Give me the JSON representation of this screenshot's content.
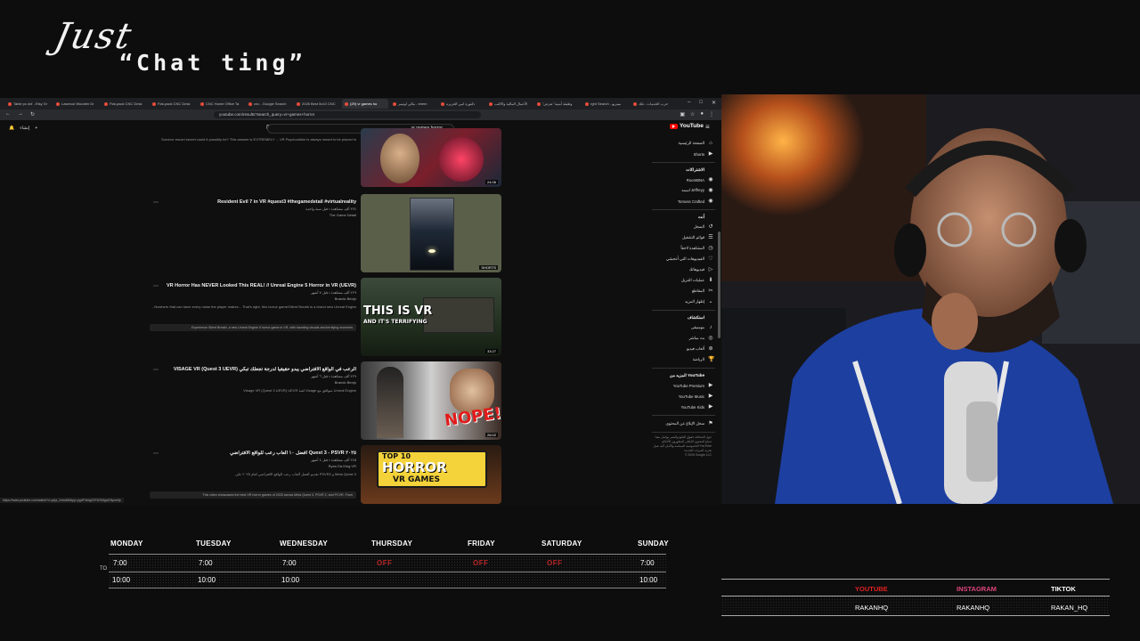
{
  "overlay": {
    "title_line1": "Just",
    "title_line2": "“Chat ting”"
  },
  "browser": {
    "tabs": [
      {
        "label": "Table pc dxf - Etsy Gr",
        "active": false
      },
      {
        "label": "Lasercut Wooden Dr",
        "active": false
      },
      {
        "label": "Flat-pack CNC Desk",
        "active": false
      },
      {
        "label": "Flat-pack CNC Desk",
        "active": false
      },
      {
        "label": "CNC Home Office Ta",
        "active": false
      },
      {
        "label": "cnc - Google Search",
        "active": false
      },
      {
        "label": "2026 Best 5x10 CNC",
        "active": false
      },
      {
        "label": "(29) vr games ho",
        "active": true
      },
      {
        "label": "مالي اوتيمر - xtrem",
        "active": false
      },
      {
        "label": "دكتورة امي الجزيره",
        "active": false
      },
      {
        "label": "الأعمال المالية والاكتب",
        "active": false
      },
      {
        "label": "\"وظيفة أمنية\" تعرض",
        "active": false
      },
      {
        "label": "rght Search - ميتريو",
        "active": false
      },
      {
        "label": "حرب الخدمات - تلك",
        "active": false
      }
    ],
    "url": "youtube.com/results?search_query=vr+games+horror",
    "status_url": "https://www.youtube.com/watch?v=yeja_Xrkw8M&pp=ygUPdnIgZ2FtZXMgaG9ycm9y"
  },
  "youtube": {
    "search_value": "vr games horror",
    "brand": "YouTube",
    "create_label": "إنشاء",
    "results": [
      {
        "title": "",
        "meta": "",
        "channel": "",
        "desc": "Survivor escort secret could it possibly be? This answer is EXTREMELY ... VR Psychostrike is always meant to be placed in",
        "duration": "24:06",
        "chapters": ""
      },
      {
        "title": "Resident Evil 7 in VR #quest3 #thegamedetail #virtualreality",
        "meta": "٢٢٤ ألف مشاهدة • قبل سنة واحدة",
        "channel": "The Game Detail",
        "desc": "",
        "duration": "SHORTS",
        "chapters": ""
      },
      {
        "title": "VR Horror Has NEVER Looked This REAL! // Unreal Engine 5 Horror in VR (UEVR)",
        "meta": "٢٢٩ ألف مشاهدة • قبل ٧ أشهر",
        "channel": "Brando Benjo",
        "desc": "...Nowhere that can have every noise the player makes... That's right, this horror game/Silent Breath is a brand new Unreal Engine 5",
        "duration": "33:27",
        "chapters": "Experience Silent Breath, a new Unreal Engine 5 horror game in VR, with haunting visuals and terrifying moments"
      },
      {
        "title": "VISAGE VR (Quest 3 UEVR) الرعب في الواقع الافتراضي يبدو حقيقياً لدرجة تجعلك تبكي",
        "meta": "٢٢٩ ألف مشاهدة • قبل ٦ أشهر",
        "channel": "Brando Benjo",
        "desc": "Visage VR (Quest 3 UEVR) UEVR لعبة Visage متوافق مع Unreal Engine",
        "duration": "26:02",
        "chapters": ""
      },
      {
        "title": "أفضل ١٠ ألعاب رعب للواقع الافتراضي Quest 3 - PSVR ٢٠٢٥",
        "meta": "٢٤٥ ألف مشاهدة • قبل ٤ أشهر",
        "channel": "Ryan Da King VR",
        "desc": "تقديم أفضل ألعاب رعب الواقع الافتراضي لعام ٢٠٢٥ على PSVR2 و Meta Quest 3",
        "duration": "",
        "chapters": "This video showcases the best VR horror games of 2025 across Meta Quest 3, PSVR 2, and PCVR. From"
      }
    ],
    "thumb_texts": {
      "t3_line1": "THIS IS VR",
      "t3_line2": "AND IT'S TERRIFYING",
      "t4": "NOPE!",
      "t5_line1": "TOP 10",
      "t5_line2": "HORROR",
      "t5_line3": "VR GAMES"
    },
    "sidebar": {
      "primary": [
        "الصفحة الرئيسية",
        "Shorts"
      ],
      "subs_head": "الاشتراكات",
      "subs": [
        "RoomBNA",
        "اسمه Jeffreyy",
        "Tomoss Crafted"
      ],
      "you_head": "أنت",
      "you": [
        "السجل",
        "قوائم التشغيل",
        "المشاهدة لاحقاً",
        "الفيديوهات التي أعجبتني",
        "فيديوهاتك",
        "عمليات التنزيل",
        "المقاطع",
        "إظهار المزيد"
      ],
      "explore_head": "استكشاف",
      "explore": [
        "موسيقى",
        "بث مباشر",
        "ألعاب فيديو",
        "الرياضة"
      ],
      "more_head": "المزيد من YouTube",
      "more": [
        "YouTube Premium",
        "YouTube Music",
        "YouTube Kids"
      ],
      "report": "سجل الإبلاغ عن المحتوى",
      "footer": "حول  الصحافة  حقوق الطبع والنشر  تواصل معنا  صناع المحتوى  الإعلان  المطورون  الأحكام  الخصوصية  السياسة والأمان  آلية عمل YouTube  تجربة الميزات الجديدة",
      "copyright": "© 2026 Google LLC"
    }
  },
  "schedule": {
    "to_label": "TO",
    "days": [
      {
        "day": "MONDAY",
        "start": "7:00",
        "end": "10:00",
        "off": false
      },
      {
        "day": "TUESDAY",
        "start": "7:00",
        "end": "10:00",
        "off": false
      },
      {
        "day": "WEDNESDAY",
        "start": "7:00",
        "end": "10:00",
        "off": false
      },
      {
        "day": "THURSDAY",
        "start": "OFF",
        "end": "",
        "off": true
      },
      {
        "day": "FRIDAY",
        "start": "OFF",
        "end": "",
        "off": true
      },
      {
        "day": "SATURDAY",
        "start": "OFF",
        "end": "",
        "off": true
      },
      {
        "day": "SUNDAY",
        "start": "7:00",
        "end": "10:00",
        "off": false
      }
    ]
  },
  "socials": [
    {
      "platform": "YOUTUBE",
      "handle": "RAKANHQ",
      "color": "#e02020"
    },
    {
      "platform": "INSTAGRAM",
      "handle": "RAKANHQ",
      "color": "#e0457b"
    },
    {
      "platform": "TIKTOK",
      "handle": "RAKAN_HQ",
      "color": "#ffffff"
    }
  ],
  "colors": {
    "accent_red": "#d42b2b",
    "youtube_red": "#ff0000",
    "background": "#0d0d0e"
  }
}
